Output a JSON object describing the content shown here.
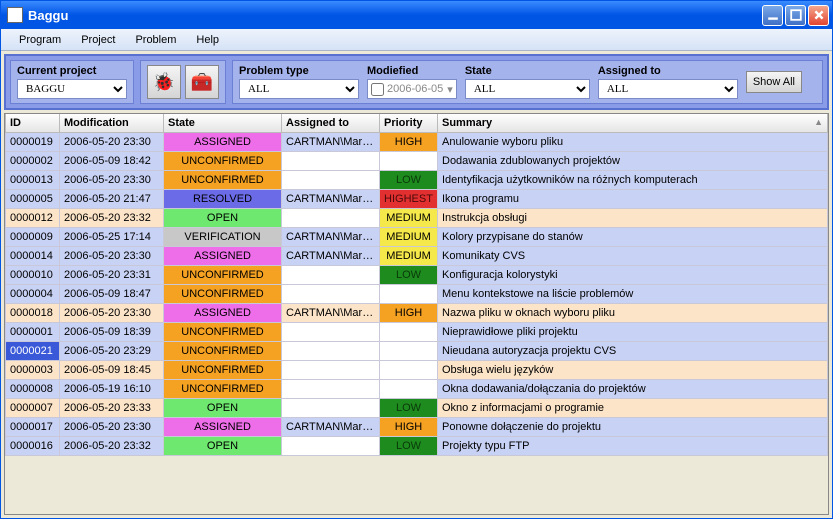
{
  "window": {
    "title": "Baggu"
  },
  "menu": [
    "Program",
    "Project",
    "Problem",
    "Help"
  ],
  "toolbar": {
    "currentProjectLabel": "Current project",
    "currentProject": {
      "value": "BAGGU"
    },
    "problemTypeLabel": "Problem type",
    "problemType": {
      "value": "ALL"
    },
    "modifiedLabel": "Modiefied",
    "modifiedDate": "2006-06-05",
    "stateLabel": "State",
    "state": {
      "value": "ALL"
    },
    "assignedLabel": "Assigned to",
    "assigned": {
      "value": "ALL"
    },
    "showAll": "Show All"
  },
  "columns": [
    "ID",
    "Modification",
    "State",
    "Assigned to",
    "Priority",
    "Summary"
  ],
  "sortColumn": "Summary",
  "selectedId": "0000021",
  "colors": {
    "state": {
      "ASSIGNED": "#ee6eea",
      "UNCONFIRMED": "#f5a223",
      "RESOLVED": "#6b6be8",
      "OPEN": "#6ee86e",
      "VERIFICATION": "#c8c8c8"
    },
    "priority": {
      "HIGH": "#f5a223",
      "LOW": "#1e8b1e",
      "HIGHEST": "#e23030",
      "MEDIUM": "#f5e84a"
    },
    "priorityText": {
      "LOW": "#0a3a0a",
      "HIGHEST": "#4a0a0a"
    }
  },
  "rows": [
    {
      "id": "0000019",
      "mod": "2006-05-20 23:30",
      "state": "ASSIGNED",
      "assigned": "CARTMAN\\Marcin",
      "priority": "HIGH",
      "summary": "Anulowanie wyboru pliku",
      "stripe": "even"
    },
    {
      "id": "0000002",
      "mod": "2006-05-09 18:42",
      "state": "UNCONFIRMED",
      "assigned": "",
      "priority": "",
      "summary": "Dodawania zdublowanych projektów",
      "stripe": "even"
    },
    {
      "id": "0000013",
      "mod": "2006-05-20 23:30",
      "state": "UNCONFIRMED",
      "assigned": "",
      "priority": "LOW",
      "summary": "Identyfikacja użytkowników na różnych komputerach",
      "stripe": "even"
    },
    {
      "id": "0000005",
      "mod": "2006-05-20 21:47",
      "state": "RESOLVED",
      "assigned": "CARTMAN\\Marcin",
      "priority": "HIGHEST",
      "summary": "Ikona programu",
      "stripe": "even"
    },
    {
      "id": "0000012",
      "mod": "2006-05-20 23:32",
      "state": "OPEN",
      "assigned": "",
      "priority": "MEDIUM",
      "summary": "Instrukcja obsługi",
      "stripe": "odd"
    },
    {
      "id": "0000009",
      "mod": "2006-05-25 17:14",
      "state": "VERIFICATION",
      "assigned": "CARTMAN\\Marcin",
      "priority": "MEDIUM",
      "summary": "Kolory przypisane do stanów",
      "stripe": "even"
    },
    {
      "id": "0000014",
      "mod": "2006-05-20 23:30",
      "state": "ASSIGNED",
      "assigned": "CARTMAN\\Marcin",
      "priority": "MEDIUM",
      "summary": "Komunikaty CVS",
      "stripe": "even"
    },
    {
      "id": "0000010",
      "mod": "2006-05-20 23:31",
      "state": "UNCONFIRMED",
      "assigned": "",
      "priority": "LOW",
      "summary": "Konfiguracja kolorystyki",
      "stripe": "even"
    },
    {
      "id": "0000004",
      "mod": "2006-05-09 18:47",
      "state": "UNCONFIRMED",
      "assigned": "",
      "priority": "",
      "summary": "Menu kontekstowe na liście problemów",
      "stripe": "even"
    },
    {
      "id": "0000018",
      "mod": "2006-05-20 23:30",
      "state": "ASSIGNED",
      "assigned": "CARTMAN\\Marcin",
      "priority": "HIGH",
      "summary": "Nazwa pliku w oknach wyboru pliku",
      "stripe": "odd"
    },
    {
      "id": "0000001",
      "mod": "2006-05-09 18:39",
      "state": "UNCONFIRMED",
      "assigned": "",
      "priority": "",
      "summary": "Nieprawidłowe pliki projektu",
      "stripe": "even"
    },
    {
      "id": "0000021",
      "mod": "2006-05-20 23:29",
      "state": "UNCONFIRMED",
      "assigned": "",
      "priority": "",
      "summary": "Nieudana autoryzacja projektu CVS",
      "stripe": "even"
    },
    {
      "id": "0000003",
      "mod": "2006-05-09 18:45",
      "state": "UNCONFIRMED",
      "assigned": "",
      "priority": "",
      "summary": "Obsługa wielu języków",
      "stripe": "odd"
    },
    {
      "id": "0000008",
      "mod": "2006-05-19 16:10",
      "state": "UNCONFIRMED",
      "assigned": "",
      "priority": "",
      "summary": "Okna dodawania/dołączania do projektów",
      "stripe": "even"
    },
    {
      "id": "0000007",
      "mod": "2006-05-20 23:33",
      "state": "OPEN",
      "assigned": "",
      "priority": "LOW",
      "summary": "Okno z informacjami o programie",
      "stripe": "odd"
    },
    {
      "id": "0000017",
      "mod": "2006-05-20 23:30",
      "state": "ASSIGNED",
      "assigned": "CARTMAN\\Marcin",
      "priority": "HIGH",
      "summary": "Ponowne dołączenie do projektu",
      "stripe": "even"
    },
    {
      "id": "0000016",
      "mod": "2006-05-20 23:32",
      "state": "OPEN",
      "assigned": "",
      "priority": "LOW",
      "summary": "Projekty typu FTP",
      "stripe": "even"
    }
  ]
}
